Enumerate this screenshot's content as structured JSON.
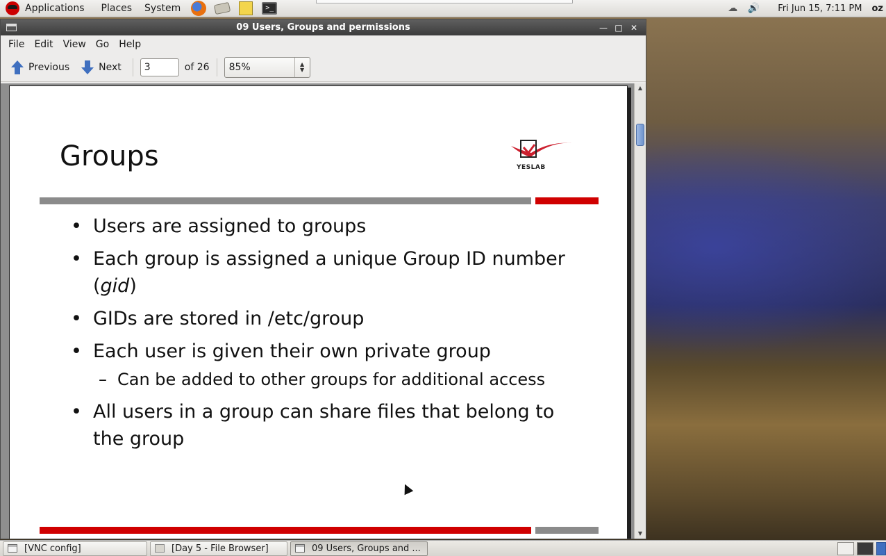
{
  "top_panel": {
    "menus": [
      "Applications",
      "Places",
      "System"
    ],
    "launchers": [
      "firefox-icon",
      "mail-client-icon",
      "text-editor-icon",
      "terminal-icon"
    ],
    "clock": "Fri Jun 15,  7:11 PM",
    "user": "oz"
  },
  "window": {
    "title": "09 Users, Groups and permissions",
    "menu": [
      "File",
      "Edit",
      "View",
      "Go",
      "Help"
    ],
    "toolbar": {
      "previous_label": "Previous",
      "next_label": "Next",
      "page_value": "3",
      "page_total": "of 26",
      "zoom": "85%"
    }
  },
  "slide": {
    "title": "Groups",
    "logo_text": "YESLAB",
    "bullets": [
      "Users are assigned to groups",
      "Each group is assigned a unique Group ID number (gid)",
      "GIDs are stored in /etc/group",
      "Each user is given their own private group",
      "All users in a group can share files that belong to the group"
    ],
    "sub_bullet": "Can be added to other groups for additional access",
    "colors": {
      "accent_red": "#d00000",
      "rule_gray": "#8b8b8b"
    }
  },
  "taskbar": {
    "tasks": [
      "[VNC config]",
      "[Day 5 - File Browser]",
      "09 Users, Groups and ..."
    ]
  }
}
